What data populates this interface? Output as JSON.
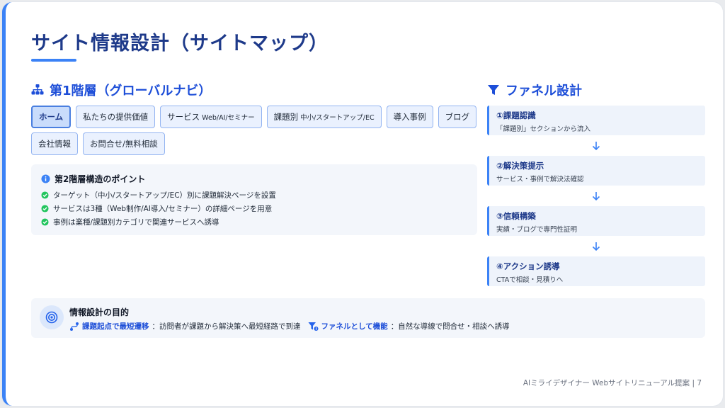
{
  "title": "サイト情報設計（サイトマップ）",
  "global_nav": {
    "heading": "第1階層（グローバルナビ）",
    "items": [
      {
        "label": "ホーム",
        "sub": ""
      },
      {
        "label": "私たちの提供価値",
        "sub": ""
      },
      {
        "label": "サービス",
        "sub": "Web/AI/セミナー"
      },
      {
        "label": "課題別",
        "sub": "中小/スタートアップ/EC"
      },
      {
        "label": "導入事例",
        "sub": ""
      },
      {
        "label": "ブログ",
        "sub": ""
      },
      {
        "label": "会社情報",
        "sub": ""
      },
      {
        "label": "お問合せ/無料相談",
        "sub": ""
      }
    ],
    "active_index": 0
  },
  "points": {
    "heading": "第2階層構造のポイント",
    "items": [
      "ターゲット（中小/スタートアップ/EC）別に課題解決ページを設置",
      "サービスは3種（Web制作/AI導入/セミナー）の詳細ページを用意",
      "事例は業種/課題別カテゴリで関連サービスへ誘導"
    ]
  },
  "funnel": {
    "heading": "ファネル設計",
    "steps": [
      {
        "title": "①課題認識",
        "desc": "「課題別」セクションから流入"
      },
      {
        "title": "②解決策提示",
        "desc": "サービス・事例で解決法確認"
      },
      {
        "title": "③信頼構築",
        "desc": "実績・ブログで専門性証明"
      },
      {
        "title": "④アクション誘導",
        "desc": "CTAで相談・見積りへ"
      }
    ]
  },
  "purpose": {
    "heading": "情報設計の目的",
    "item1_key": "課題起点で最短遷移",
    "item1_text": "：訪問者が課題から解決策へ最短経路で到達",
    "item2_key": "ファネルとして機能",
    "item2_text": "：自然な導線で問合せ・相談へ誘導"
  },
  "footer": "AIミライデザイナー Webサイトリニューアル提案 | 7",
  "colors": {
    "accent": "#3b82f6",
    "title": "#1e3a8a",
    "check": "#22c55e"
  },
  "icons": [
    "sitemap-icon",
    "info-icon",
    "check-circle-icon",
    "funnel-icon",
    "arrow-down-icon",
    "target-icon",
    "route-icon",
    "funnel-dollar-icon"
  ]
}
